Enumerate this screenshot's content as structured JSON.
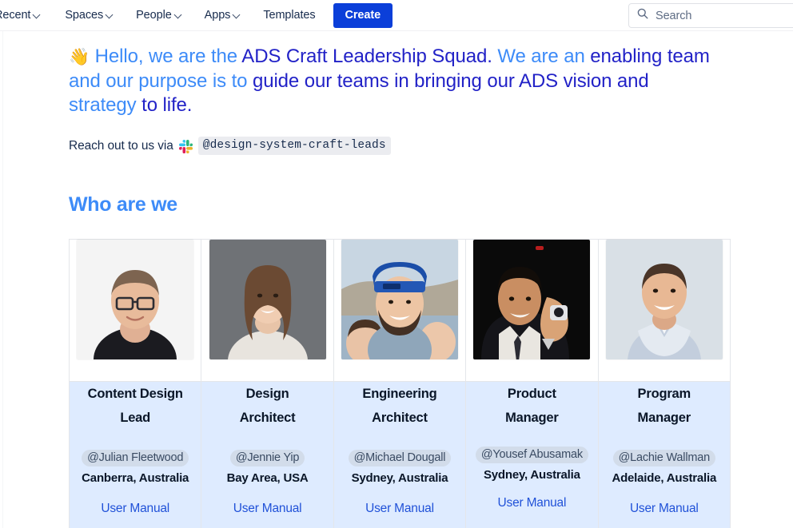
{
  "nav": {
    "items": [
      {
        "label": "Recent",
        "has_chevron": true,
        "icon": "chevron-down-icon"
      },
      {
        "label": "Spaces",
        "has_chevron": true,
        "icon": "chevron-down-icon"
      },
      {
        "label": "People",
        "has_chevron": true,
        "icon": "chevron-down-icon"
      },
      {
        "label": "Apps",
        "has_chevron": true,
        "icon": "chevron-down-icon"
      },
      {
        "label": "Templates",
        "has_chevron": false,
        "icon": ""
      }
    ],
    "create_label": "Create",
    "create_color": "#0B3FD9"
  },
  "search": {
    "placeholder": "Search",
    "icon": "search-icon"
  },
  "hero": {
    "emoji": "👋",
    "emoji_name": "waving-hand-emoji",
    "seg1": " Hello, we are the ",
    "seg2": "ADS Craft Leadership Squad.",
    "seg3": " We are an ",
    "seg4": "enabling team",
    "seg5": " and our purpose is to ",
    "seg6": "guide our teams in bringing our ADS vision and",
    "seg7": " strategy ",
    "seg8": "to life.",
    "color_light": "#3D8BF8",
    "color_dark": "#2222C7"
  },
  "reachout": {
    "text": "Reach out to us via",
    "slack_icon": "slack-icon",
    "handle": "@design-system-craft-leads"
  },
  "section": {
    "heading": "Who are we",
    "heading_color": "#3D8BF8"
  },
  "people": [
    {
      "role_line1": "Content Design",
      "role_line2": "Lead",
      "mention": "@Julian Fleetwood",
      "location": "Canberra, Australia",
      "manual_label": "User Manual",
      "photo_name": "portrait-julian-fleetwood"
    },
    {
      "role_line1": "Design",
      "role_line2": "Architect",
      "mention": "@Jennie Yip",
      "location": "Bay Area, USA",
      "manual_label": "User Manual",
      "photo_name": "portrait-jennie-yip"
    },
    {
      "role_line1": "Engineering",
      "role_line2": "Architect",
      "mention": "@Michael Dougall",
      "location": "Sydney, Australia",
      "manual_label": "User Manual",
      "photo_name": "portrait-michael-dougall"
    },
    {
      "role_line1": "Product",
      "role_line2": "Manager",
      "mention": "@Yousef Abusamak",
      "location": "Sydney, Australia",
      "manual_label": "User Manual",
      "photo_name": "portrait-yousef-abusamak"
    },
    {
      "role_line1": "Program",
      "role_line2": "Manager",
      "mention": "@Lachie Wallman",
      "location": "Adelaide, Australia",
      "manual_label": "User Manual",
      "photo_name": "portrait-lachie-wallman"
    }
  ]
}
